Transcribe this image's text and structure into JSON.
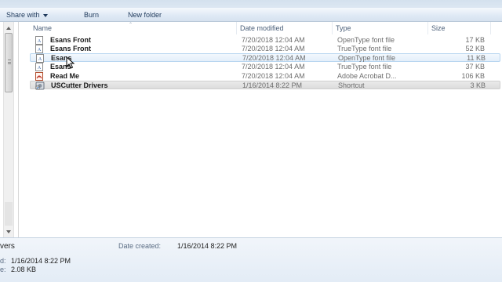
{
  "toolbar": {
    "share_with": "Share with",
    "burn": "Burn",
    "new_folder": "New folder"
  },
  "columns": {
    "name": "Name",
    "date_modified": "Date modified",
    "type": "Type",
    "size": "Size"
  },
  "files": [
    {
      "name": "Esans Front",
      "date": "7/20/2018 12:04 AM",
      "type": "OpenType font file",
      "size": "17 KB",
      "icon": "font-file-icon"
    },
    {
      "name": "Esans Front",
      "date": "7/20/2018 12:04 AM",
      "type": "TrueType font file",
      "size": "52 KB",
      "icon": "font-file-icon"
    },
    {
      "name": "Esans",
      "date": "7/20/2018 12:04 AM",
      "type": "OpenType font file",
      "size": "11 KB",
      "icon": "font-file-icon"
    },
    {
      "name": "Esans",
      "date": "7/20/2018 12:04 AM",
      "type": "TrueType font file",
      "size": "37 KB",
      "icon": "font-file-icon"
    },
    {
      "name": "Read Me",
      "date": "7/20/2018 12:04 AM",
      "type": "Adobe Acrobat D...",
      "size": "106 KB",
      "icon": "pdf-file-icon"
    },
    {
      "name": "USCutter Drivers",
      "date": "1/16/2014 8:22 PM",
      "type": "Shortcut",
      "size": "3 KB",
      "icon": "shortcut-icon"
    }
  ],
  "details_pane": {
    "item_name_partial": "vers",
    "date_created_label": "Date created:",
    "date_created_value": "1/16/2014 8:22 PM",
    "modified_label_partial": "d:",
    "modified_value": "1/16/2014 8:22 PM",
    "size_label_partial": "e:",
    "size_value": "2.08 KB"
  },
  "colors": {
    "toolbar_text": "#1e395b",
    "header_text": "#4c607a",
    "hover_border": "#b8d6f0",
    "details_bg": "#e3ecf6"
  }
}
